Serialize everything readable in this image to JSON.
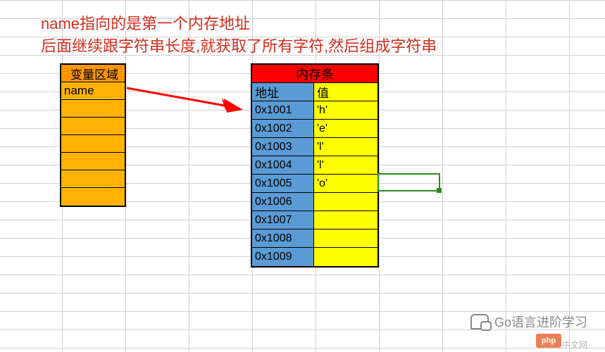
{
  "annotation": {
    "line1": "name指向的是第一个内存地址",
    "line2": "后面继续跟字符串长度,就获取了所有字符,然后组成字符串"
  },
  "var_area": {
    "header": "变量区域",
    "rows": [
      "name",
      "",
      "",
      "",
      "",
      "",
      ""
    ]
  },
  "memory": {
    "title": "内存条",
    "col1": "地址",
    "col2": "值",
    "rows": [
      {
        "addr": "0x1001",
        "val": "'h'"
      },
      {
        "addr": "0x1002",
        "val": "'e'"
      },
      {
        "addr": "0x1003",
        "val": "'l'"
      },
      {
        "addr": "0x1004",
        "val": "'l'"
      },
      {
        "addr": "0x1005",
        "val": "'o'"
      },
      {
        "addr": "0x1006",
        "val": ""
      },
      {
        "addr": "0x1007",
        "val": ""
      },
      {
        "addr": "0x1008",
        "val": ""
      },
      {
        "addr": "0x1009",
        "val": ""
      }
    ]
  },
  "watermark": {
    "text": "Go语言进阶学习",
    "site": "中文网",
    "logo": "php"
  },
  "colors": {
    "annotation": "#d22e1f",
    "var_header": "#ff9600",
    "var_row": "#ffb200",
    "mem_title": "#ff0000",
    "mem_addr": "#5b9bd5",
    "mem_val": "#ffff00",
    "selection": "#2e8b1f"
  }
}
